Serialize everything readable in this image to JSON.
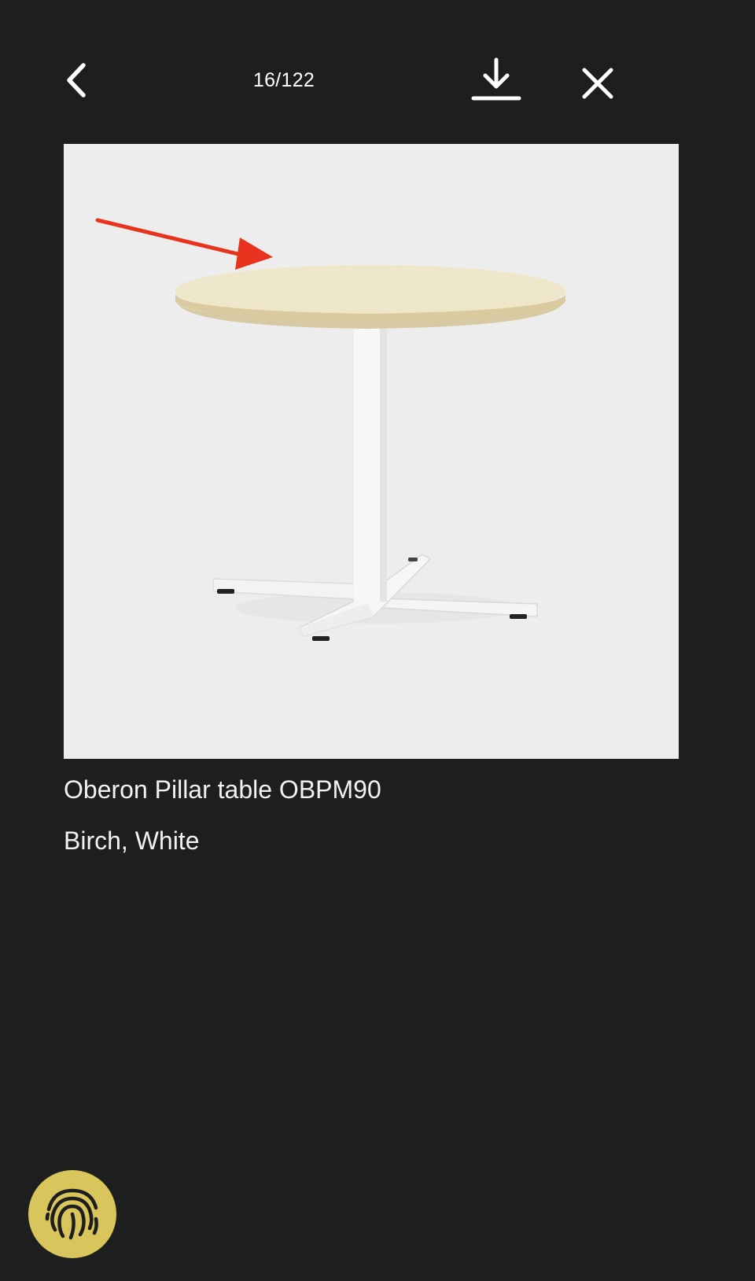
{
  "viewer": {
    "counter": "16/122"
  },
  "product": {
    "title": "Oberon Pillar table OBPM90",
    "variant": "Birch, White",
    "image_alt": "Oberon Pillar table OBPM90"
  },
  "icons": {
    "back": "chevron-left-icon",
    "download": "download-icon",
    "close": "close-icon",
    "fingerprint": "fingerprint-icon",
    "annotation": "red-arrow-icon"
  },
  "colors": {
    "background": "#1e1e1e",
    "image_background": "#ededed",
    "annotation_arrow": "#e8331e",
    "fingerprint_button": "#d8c65c"
  }
}
